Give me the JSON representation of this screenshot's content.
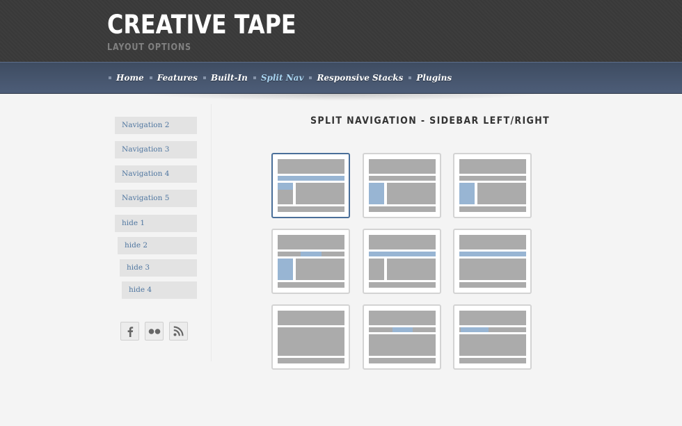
{
  "header": {
    "title": "CREATIVE TAPE",
    "subtitle": "LAYOUT OPTIONS"
  },
  "nav": {
    "items": [
      {
        "label": "Home",
        "active": false
      },
      {
        "label": "Features",
        "active": false
      },
      {
        "label": "Built-In",
        "active": false
      },
      {
        "label": "Split Nav",
        "active": true
      },
      {
        "label": "Responsive Stacks",
        "active": false
      },
      {
        "label": "Plugins",
        "active": false
      }
    ]
  },
  "sidebar": {
    "items": [
      {
        "label": "Navigation 2"
      },
      {
        "label": "Navigation 3"
      },
      {
        "label": "Navigation 4"
      },
      {
        "label": "Navigation 5"
      },
      {
        "label": "hide 1"
      },
      {
        "label": "hide 2"
      },
      {
        "label": "hide 3"
      },
      {
        "label": "hide 4"
      }
    ],
    "social": [
      {
        "icon": "facebook-icon"
      },
      {
        "icon": "flickr-icon"
      },
      {
        "icon": "rss-icon"
      }
    ]
  },
  "main": {
    "title": "SPLIT NAVIGATION - SIDEBAR LEFT/RIGHT",
    "selected_thumbnail": 1
  },
  "colors": {
    "header_bg": "#3a3a3a",
    "nav_bg": "#4a5a74",
    "nav_active": "#a9d4f0",
    "sidebar_link": "#4f76a0",
    "layout_block": "#ababab",
    "layout_highlight": "#98b5d3",
    "selected_border": "#4a6f99"
  }
}
